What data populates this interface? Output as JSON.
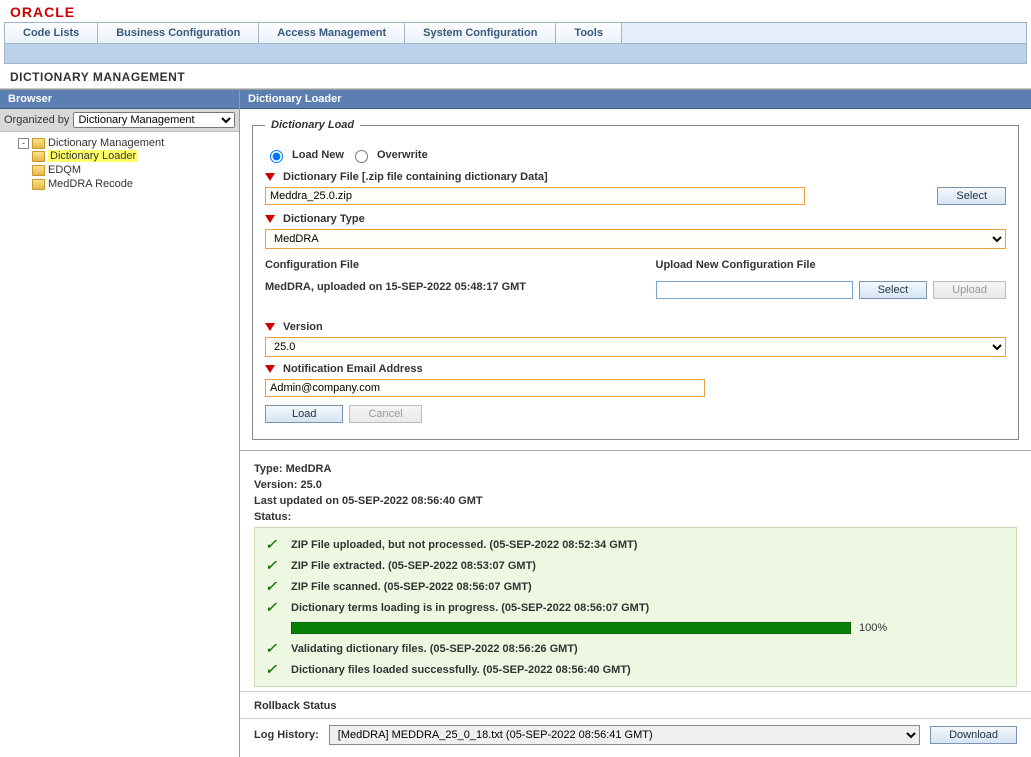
{
  "brand": "ORACLE",
  "tabs": [
    "Code Lists",
    "Business Configuration",
    "Access Management",
    "System Configuration",
    "Tools"
  ],
  "page_title": "DICTIONARY MANAGEMENT",
  "browser": {
    "header": "Browser",
    "organized_by_label": "Organized by",
    "organized_by_value": "Dictionary Management",
    "tree": {
      "root": "Dictionary Management",
      "children": [
        "Dictionary Loader",
        "EDQM",
        "MedDRA Recode"
      ],
      "selected": "Dictionary Loader"
    }
  },
  "loader": {
    "header": "Dictionary Loader",
    "fieldset_title": "Dictionary Load",
    "radios": {
      "load_new": "Load New",
      "overwrite": "Overwrite"
    },
    "dict_file_label": "Dictionary File [.zip file containing dictionary Data]",
    "dict_file_value": "Meddra_25.0.zip",
    "select_btn": "Select",
    "dict_type_label": "Dictionary Type",
    "dict_type_value": "MedDRA",
    "config_label": "Configuration File",
    "config_text": "MedDRA, uploaded on 15-SEP-2022 05:48:17 GMT",
    "upload_new_label": "Upload New Configuration File",
    "upload_btn": "Upload",
    "version_label": "Version",
    "version_value": "25.0",
    "email_label": "Notification Email Address",
    "email_value": "Admin@company.com",
    "load_btn": "Load",
    "cancel_btn": "Cancel"
  },
  "info": {
    "type_label": "Type:",
    "type_value": "MedDRA",
    "version_label": "Version:",
    "version_value": "25.0",
    "updated_label": "Last updated on",
    "updated_value": "05-SEP-2022 08:56:40 GMT",
    "status_label": "Status:"
  },
  "status_items": [
    "ZIP File uploaded, but not processed. (05-SEP-2022 08:52:34 GMT)",
    "ZIP File extracted. (05-SEP-2022 08:53:07 GMT)",
    "ZIP File scanned. (05-SEP-2022 08:56:07 GMT)",
    "Dictionary terms loading is in progress. (05-SEP-2022 08:56:07 GMT)",
    "Validating dictionary files. (05-SEP-2022 08:56:26 GMT)",
    "Dictionary files loaded successfully. (05-SEP-2022 08:56:40 GMT)"
  ],
  "progress_pct": "100%",
  "rollback_label": "Rollback Status",
  "log": {
    "label": "Log History:",
    "value": "[MedDRA] MEDDRA_25_0_18.txt (05-SEP-2022 08:56:41 GMT)",
    "download": "Download"
  }
}
